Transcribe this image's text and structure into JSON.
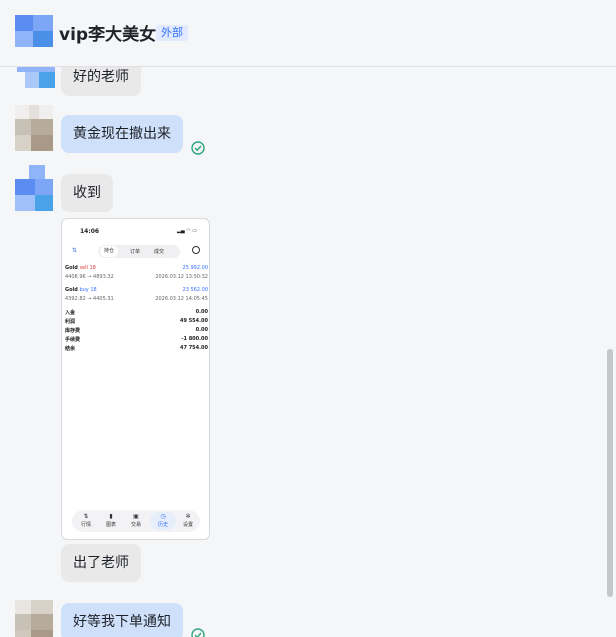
{
  "chat": {
    "name": "vip李大美女",
    "badge": "外部"
  },
  "colors": {
    "incoming_bubble": "#e9e9ea",
    "outgoing_bubble": "#cfe0fb",
    "badge_bg": "#e1eaff",
    "badge_text": "#3370ff",
    "read_check": "#2fa57e"
  },
  "messages": [
    {
      "from": "contact",
      "text": "好的老师"
    },
    {
      "from": "me",
      "text": "黄金现在撤出来",
      "status_icon": "read-check-icon"
    },
    {
      "from": "contact",
      "text": "收到"
    },
    {
      "from": "contact",
      "type": "image"
    },
    {
      "from": "contact",
      "text": "出了老师"
    },
    {
      "from": "me",
      "text": "好等我下单通知",
      "status_icon": "read-check-icon"
    }
  ],
  "screenshot": {
    "time": "14:06",
    "segments": [
      "持仓",
      "订单",
      "成交"
    ],
    "trades": [
      {
        "symbol": "Gold",
        "side": "sell",
        "lots": "18",
        "profit": "25 992.00",
        "prices": "4408.96 → 4893.32",
        "date": "2026.03.12 13:50:32"
      },
      {
        "symbol": "Gold",
        "side": "buy",
        "lots": "18",
        "profit": "23 562.00",
        "prices": "4392.82 → 4405.31",
        "date": "2026.03.12 14:05:45"
      }
    ],
    "summary": [
      {
        "label": "入金",
        "value": "0.00"
      },
      {
        "label": "利润",
        "value": "49 554.00"
      },
      {
        "label": "库存费",
        "value": "0.00"
      },
      {
        "label": "手续费",
        "value": "-1 800.00"
      },
      {
        "label": "结余",
        "value": "47 754.00"
      }
    ],
    "tabs": [
      "行情",
      "图表",
      "交易",
      "历史",
      "设置"
    ],
    "active_tab": "历史"
  }
}
